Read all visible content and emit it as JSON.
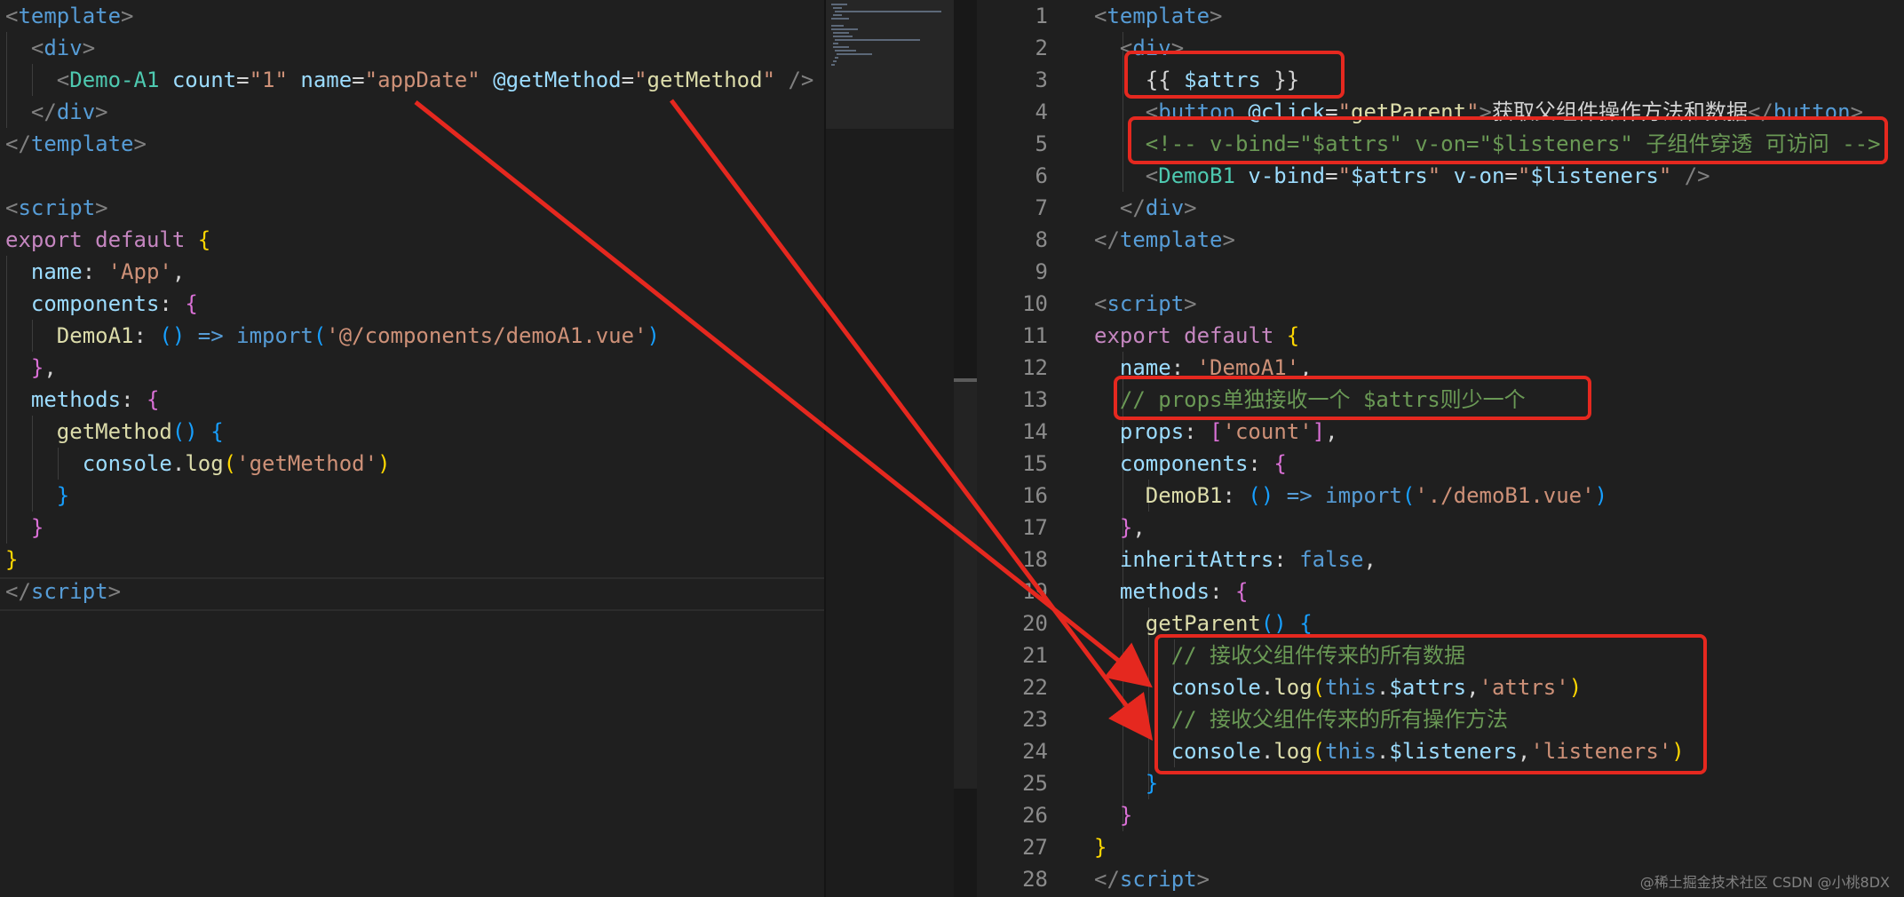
{
  "left_editor": {
    "lines": [
      [
        [
          "brk",
          "<"
        ],
        [
          "tag",
          "template"
        ],
        [
          "brk",
          ">"
        ]
      ],
      [
        [
          "txt",
          "  "
        ],
        [
          "brk",
          "<"
        ],
        [
          "tag",
          "div"
        ],
        [
          "brk",
          ">"
        ]
      ],
      [
        [
          "txt",
          "    "
        ],
        [
          "brk",
          "<"
        ],
        [
          "comp",
          "Demo-A1"
        ],
        [
          "txt",
          " "
        ],
        [
          "attr",
          "count"
        ],
        [
          "txt",
          "="
        ],
        [
          "str",
          "\"1\""
        ],
        [
          "txt",
          " "
        ],
        [
          "attr",
          "name"
        ],
        [
          "txt",
          "="
        ],
        [
          "str",
          "\"appDate\""
        ],
        [
          "txt",
          " "
        ],
        [
          "attr",
          "@getMethod"
        ],
        [
          "txt",
          "="
        ],
        [
          "str",
          "\""
        ],
        [
          "fn",
          "getMethod"
        ],
        [
          "str",
          "\""
        ],
        [
          "txt",
          " "
        ],
        [
          "brk",
          "/>"
        ]
      ],
      [
        [
          "txt",
          "  "
        ],
        [
          "brk",
          "</"
        ],
        [
          "tag",
          "div"
        ],
        [
          "brk",
          ">"
        ]
      ],
      [
        [
          "brk",
          "</"
        ],
        [
          "tag",
          "template"
        ],
        [
          "brk",
          ">"
        ]
      ],
      [],
      [
        [
          "brk",
          "<"
        ],
        [
          "tag",
          "script"
        ],
        [
          "brk",
          ">"
        ]
      ],
      [
        [
          "kw",
          "export"
        ],
        [
          "txt",
          " "
        ],
        [
          "kw",
          "default"
        ],
        [
          "txt",
          " "
        ],
        [
          "br1",
          "{"
        ]
      ],
      [
        [
          "txt",
          "  "
        ],
        [
          "prop",
          "name"
        ],
        [
          "txt",
          ": "
        ],
        [
          "str",
          "'App'"
        ],
        [
          "txt",
          ","
        ]
      ],
      [
        [
          "txt",
          "  "
        ],
        [
          "prop",
          "components"
        ],
        [
          "txt",
          ": "
        ],
        [
          "br2",
          "{"
        ]
      ],
      [
        [
          "txt",
          "    "
        ],
        [
          "fn",
          "DemoA1"
        ],
        [
          "txt",
          ": "
        ],
        [
          "br3",
          "()"
        ],
        [
          "txt",
          " "
        ],
        [
          "kwb",
          "=>"
        ],
        [
          "txt",
          " "
        ],
        [
          "kwb",
          "import"
        ],
        [
          "br3",
          "("
        ],
        [
          "str",
          "'@/components/demoA1.vue'"
        ],
        [
          "br3",
          ")"
        ]
      ],
      [
        [
          "txt",
          "  "
        ],
        [
          "br2",
          "}"
        ],
        [
          "txt",
          ","
        ]
      ],
      [
        [
          "txt",
          "  "
        ],
        [
          "prop",
          "methods"
        ],
        [
          "txt",
          ": "
        ],
        [
          "br2",
          "{"
        ]
      ],
      [
        [
          "txt",
          "    "
        ],
        [
          "fn",
          "getMethod"
        ],
        [
          "br3",
          "()"
        ],
        [
          "txt",
          " "
        ],
        [
          "br3",
          "{"
        ]
      ],
      [
        [
          "txt",
          "      "
        ],
        [
          "prop",
          "console"
        ],
        [
          "txt",
          "."
        ],
        [
          "fn",
          "log"
        ],
        [
          "br1",
          "("
        ],
        [
          "str",
          "'getMethod'"
        ],
        [
          "br1",
          ")"
        ]
      ],
      [
        [
          "txt",
          "    "
        ],
        [
          "br3",
          "}"
        ]
      ],
      [
        [
          "txt",
          "  "
        ],
        [
          "br2",
          "}"
        ]
      ],
      [
        [
          "br1",
          "}"
        ]
      ],
      [
        [
          "brk",
          "</"
        ],
        [
          "tag",
          "script"
        ],
        [
          "brk",
          ">"
        ]
      ]
    ]
  },
  "right_editor": {
    "line_numbers": [
      "1",
      "2",
      "3",
      "4",
      "5",
      "6",
      "7",
      "8",
      "9",
      "10",
      "11",
      "12",
      "13",
      "14",
      "15",
      "16",
      "17",
      "18",
      "19",
      "20",
      "21",
      "22",
      "23",
      "24",
      "25",
      "26",
      "27",
      "28"
    ],
    "lines": [
      [
        [
          "brk",
          "<"
        ],
        [
          "tag",
          "template"
        ],
        [
          "brk",
          ">"
        ]
      ],
      [
        [
          "txt",
          "  "
        ],
        [
          "brk",
          "<"
        ],
        [
          "tag",
          "div"
        ],
        [
          "brk",
          ">"
        ]
      ],
      [
        [
          "txt",
          "    "
        ],
        [
          "txt",
          "{{ "
        ],
        [
          "prop",
          "$attrs"
        ],
        [
          "txt",
          " }}"
        ]
      ],
      [
        [
          "txt",
          "    "
        ],
        [
          "brk",
          "<"
        ],
        [
          "tag",
          "button"
        ],
        [
          "txt",
          " "
        ],
        [
          "attr",
          "@click"
        ],
        [
          "txt",
          "="
        ],
        [
          "str",
          "\""
        ],
        [
          "fn",
          "getParent"
        ],
        [
          "str",
          "\""
        ],
        [
          "brk",
          ">"
        ],
        [
          "txt",
          "获取父组件操作方法和数据"
        ],
        [
          "brk",
          "</"
        ],
        [
          "tag",
          "button"
        ],
        [
          "brk",
          ">"
        ]
      ],
      [
        [
          "txt",
          "    "
        ],
        [
          "cmt",
          "<!-- v-bind=\"$attrs\" v-on=\"$listeners\" 子组件穿透 可访问 -->"
        ]
      ],
      [
        [
          "txt",
          "    "
        ],
        [
          "brk",
          "<"
        ],
        [
          "comp",
          "DemoB1"
        ],
        [
          "txt",
          " "
        ],
        [
          "attr",
          "v-bind"
        ],
        [
          "txt",
          "="
        ],
        [
          "str",
          "\""
        ],
        [
          "prop",
          "$attrs"
        ],
        [
          "str",
          "\""
        ],
        [
          "txt",
          " "
        ],
        [
          "attr",
          "v-on"
        ],
        [
          "txt",
          "="
        ],
        [
          "str",
          "\""
        ],
        [
          "prop",
          "$listeners"
        ],
        [
          "str",
          "\""
        ],
        [
          "txt",
          " "
        ],
        [
          "brk",
          "/>"
        ]
      ],
      [
        [
          "txt",
          "  "
        ],
        [
          "brk",
          "</"
        ],
        [
          "tag",
          "div"
        ],
        [
          "brk",
          ">"
        ]
      ],
      [
        [
          "brk",
          "</"
        ],
        [
          "tag",
          "template"
        ],
        [
          "brk",
          ">"
        ]
      ],
      [],
      [
        [
          "brk",
          "<"
        ],
        [
          "tag",
          "script"
        ],
        [
          "brk",
          ">"
        ]
      ],
      [
        [
          "kw",
          "export"
        ],
        [
          "txt",
          " "
        ],
        [
          "kw",
          "default"
        ],
        [
          "txt",
          " "
        ],
        [
          "br1",
          "{"
        ]
      ],
      [
        [
          "txt",
          "  "
        ],
        [
          "prop",
          "name"
        ],
        [
          "txt",
          ": "
        ],
        [
          "str",
          "'DemoA1'"
        ],
        [
          "txt",
          ","
        ]
      ],
      [
        [
          "txt",
          "  "
        ],
        [
          "cmt",
          "// props单独接收一个 $attrs则少一个"
        ]
      ],
      [
        [
          "txt",
          "  "
        ],
        [
          "prop",
          "props"
        ],
        [
          "txt",
          ": "
        ],
        [
          "br2",
          "["
        ],
        [
          "str",
          "'count'"
        ],
        [
          "br2",
          "]"
        ],
        [
          "txt",
          ","
        ]
      ],
      [
        [
          "txt",
          "  "
        ],
        [
          "prop",
          "components"
        ],
        [
          "txt",
          ": "
        ],
        [
          "br2",
          "{"
        ]
      ],
      [
        [
          "txt",
          "    "
        ],
        [
          "fn",
          "DemoB1"
        ],
        [
          "txt",
          ": "
        ],
        [
          "br3",
          "()"
        ],
        [
          "txt",
          " "
        ],
        [
          "kwb",
          "=>"
        ],
        [
          "txt",
          " "
        ],
        [
          "kwb",
          "import"
        ],
        [
          "br3",
          "("
        ],
        [
          "str",
          "'./demoB1.vue'"
        ],
        [
          "br3",
          ")"
        ]
      ],
      [
        [
          "txt",
          "  "
        ],
        [
          "br2",
          "}"
        ],
        [
          "txt",
          ","
        ]
      ],
      [
        [
          "txt",
          "  "
        ],
        [
          "prop",
          "inheritAttrs"
        ],
        [
          "txt",
          ": "
        ],
        [
          "kwb",
          "false"
        ],
        [
          "txt",
          ","
        ]
      ],
      [
        [
          "txt",
          "  "
        ],
        [
          "prop",
          "methods"
        ],
        [
          "txt",
          ": "
        ],
        [
          "br2",
          "{"
        ]
      ],
      [
        [
          "txt",
          "    "
        ],
        [
          "fn",
          "getParent"
        ],
        [
          "br3",
          "()"
        ],
        [
          "txt",
          " "
        ],
        [
          "br3",
          "{"
        ]
      ],
      [
        [
          "txt",
          "      "
        ],
        [
          "cmt",
          "// 接收父组件传来的所有数据"
        ]
      ],
      [
        [
          "txt",
          "      "
        ],
        [
          "prop",
          "console"
        ],
        [
          "txt",
          "."
        ],
        [
          "fn",
          "log"
        ],
        [
          "br1",
          "("
        ],
        [
          "kwb",
          "this"
        ],
        [
          "txt",
          "."
        ],
        [
          "prop",
          "$attrs"
        ],
        [
          "txt",
          ","
        ],
        [
          "str",
          "'attrs'"
        ],
        [
          "br1",
          ")"
        ]
      ],
      [
        [
          "txt",
          "      "
        ],
        [
          "cmt",
          "// 接收父组件传来的所有操作方法"
        ]
      ],
      [
        [
          "txt",
          "      "
        ],
        [
          "prop",
          "console"
        ],
        [
          "txt",
          "."
        ],
        [
          "fn",
          "log"
        ],
        [
          "br1",
          "("
        ],
        [
          "kwb",
          "this"
        ],
        [
          "txt",
          "."
        ],
        [
          "prop",
          "$listeners"
        ],
        [
          "txt",
          ","
        ],
        [
          "str",
          "'listeners'"
        ],
        [
          "br1",
          ")"
        ]
      ],
      [
        [
          "txt",
          "    "
        ],
        [
          "br3",
          "}"
        ]
      ],
      [
        [
          "txt",
          "  "
        ],
        [
          "br2",
          "}"
        ]
      ],
      [
        [
          "br1",
          "}"
        ]
      ],
      [
        [
          "brk",
          "</"
        ],
        [
          "tag",
          "script"
        ],
        [
          "brk",
          ">"
        ]
      ]
    ]
  },
  "watermark": "@稀土掘金技术社区 CSDN @小桃8DX",
  "colors": {
    "background": "#1f1f1f",
    "annotation_red": "#e5281f"
  }
}
